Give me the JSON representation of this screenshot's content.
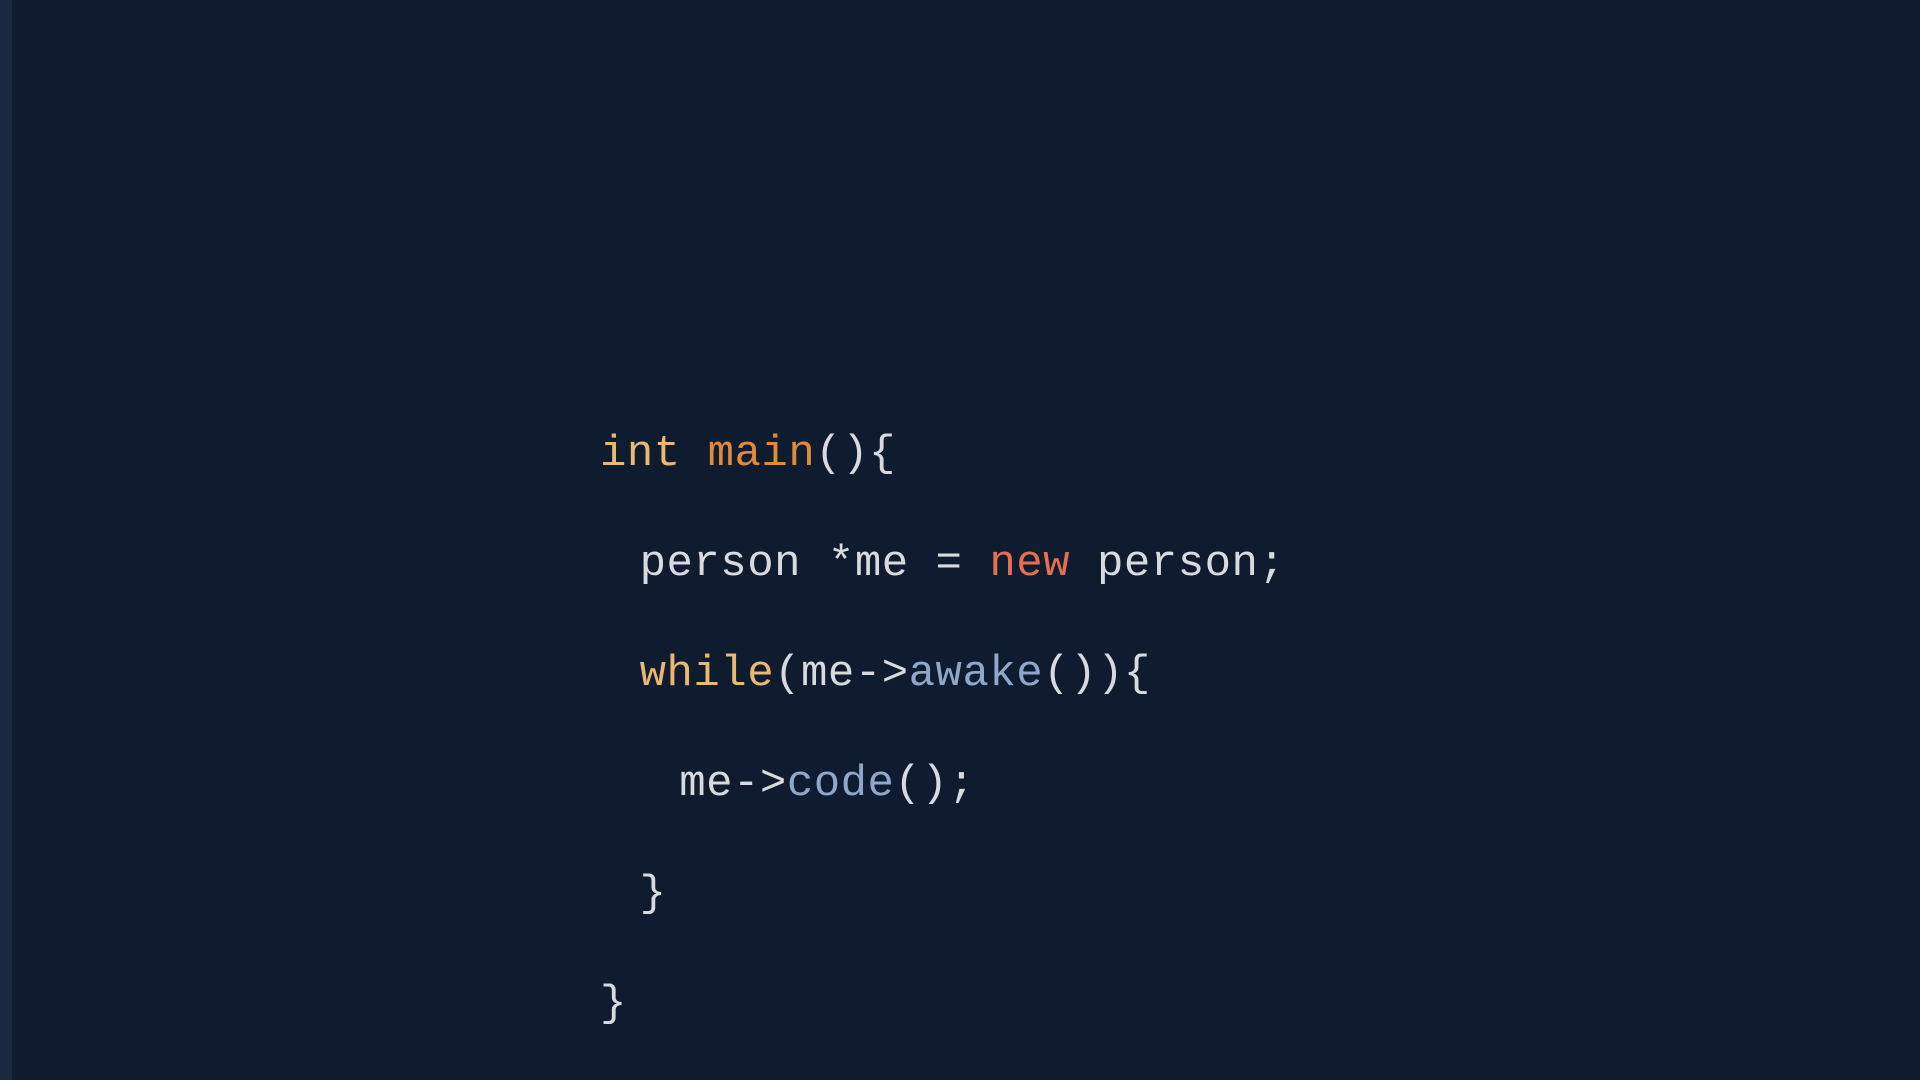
{
  "code": {
    "l1": {
      "t_int": "int",
      "t_main": "main",
      "t_open": "(){",
      "space": " "
    },
    "l2": {
      "t_type": "person",
      "t_star": " *",
      "t_var": "me",
      "t_eq": " = ",
      "t_new": "new",
      "t_sp": " ",
      "t_obj": "person",
      "t_semi": ";"
    },
    "l3": {
      "t_while": "while",
      "t_lp": "(",
      "t_me": "me",
      "t_arrow": "->",
      "t_awake": "awake",
      "t_rp": "()){"
    },
    "l4": {
      "t_me": "me",
      "t_arrow": "->",
      "t_code": "code",
      "t_call": "();"
    },
    "l5": {
      "t_close": "}"
    },
    "l6": {
      "t_close": "}"
    }
  },
  "colors": {
    "background": "#0f1b2e",
    "gutter": "#1a2940",
    "type": "#e9b872",
    "func": "#e08a3a",
    "new": "#e76f51",
    "method": "#8fa8c9",
    "text": "#d7dbe0"
  }
}
